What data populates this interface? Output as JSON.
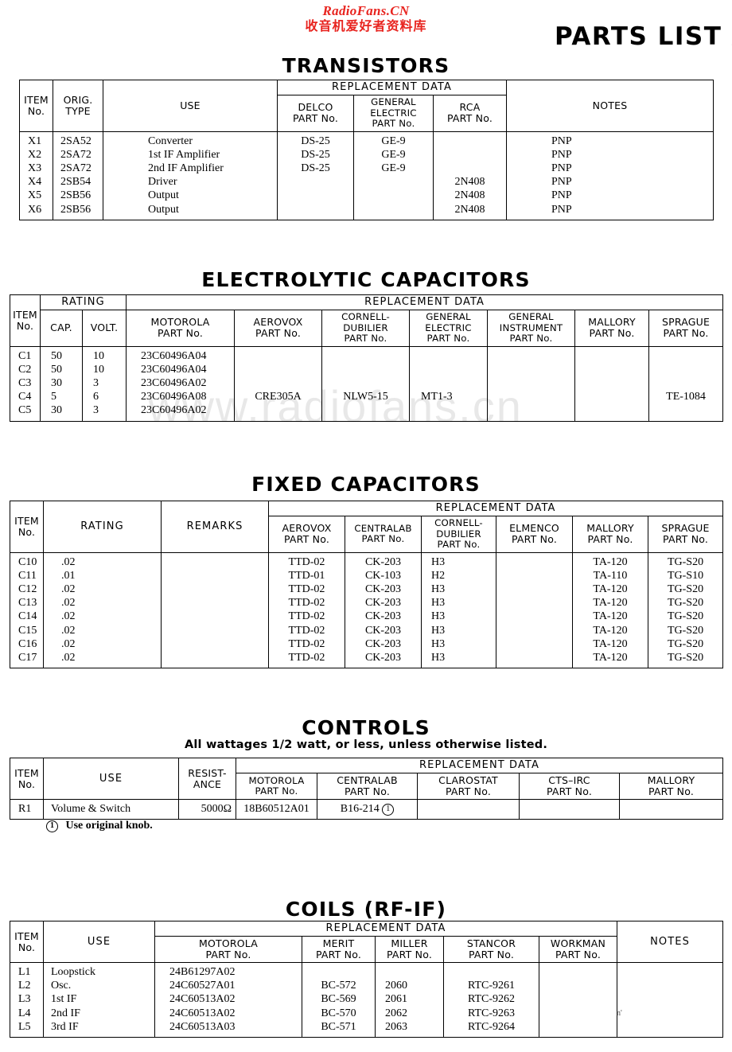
{
  "watermark": {
    "top_line1": "RadioFans.CN",
    "top_line2": "收音机爱好者资料库",
    "faint": "www.radiofans.cn"
  },
  "page_title": "PARTS LIST AN",
  "common": {
    "replacement_data": "REPLACEMENT DATA",
    "item_no": "ITEM\nNo.",
    "item_line1": "ITEM",
    "item_line2": "No.",
    "use": "USE",
    "notes": "NOTES",
    "part_no": "PART No."
  },
  "transistors": {
    "title": "TRANSISTORS",
    "headers": {
      "item_l1": "ITEM",
      "item_l2": "No.",
      "orig_l1": "ORIG.",
      "orig_l2": "TYPE",
      "use": "USE",
      "group": "REPLACEMENT DATA",
      "delco_l1": "DELCO",
      "delco_l2": "PART No.",
      "ge_l1": "GENERAL",
      "ge_l2": "ELECTRIC",
      "ge_l3": "PART No.",
      "rca_l1": "RCA",
      "rca_l2": "PART No.",
      "notes": "NOTES"
    },
    "rows": [
      {
        "item": "X1",
        "orig": "2SA52",
        "use": "Converter",
        "delco": "DS-25",
        "ge": "GE-9",
        "rca": "",
        "notes": "PNP"
      },
      {
        "item": "X2",
        "orig": "2SA72",
        "use": "1st IF Amplifier",
        "delco": "DS-25",
        "ge": "GE-9",
        "rca": "",
        "notes": "PNP"
      },
      {
        "item": "X3",
        "orig": "2SA72",
        "use": "2nd IF Amplifier",
        "delco": "DS-25",
        "ge": "GE-9",
        "rca": "",
        "notes": "PNP"
      },
      {
        "item": "X4",
        "orig": "2SB54",
        "use": "Driver",
        "delco": "",
        "ge": "",
        "rca": "2N408",
        "notes": "PNP"
      },
      {
        "item": "X5",
        "orig": "2SB56",
        "use": "Output",
        "delco": "",
        "ge": "",
        "rca": "2N408",
        "notes": "PNP"
      },
      {
        "item": "X6",
        "orig": "2SB56",
        "use": "Output",
        "delco": "",
        "ge": "",
        "rca": "2N408",
        "notes": "PNP"
      }
    ]
  },
  "electrolytic_capacitors": {
    "title": "ELECTROLYTIC CAPACITORS",
    "headers": {
      "item_l1": "ITEM",
      "item_l2": "No.",
      "rating": "RATING",
      "cap": "CAP.",
      "volt": "VOLT.",
      "group": "REPLACEMENT DATA",
      "motorola_l1": "MOTOROLA",
      "motorola_l2": "PART No.",
      "aerovox_l1": "AEROVOX",
      "aerovox_l2": "PART No.",
      "cd_l1": "CORNELL-",
      "cd_l2": "DUBILIER",
      "cd_l3": "PART No.",
      "ge_l1": "GENERAL",
      "ge_l2": "ELECTRIC",
      "ge_l3": "PART No.",
      "gi_l1": "GENERAL",
      "gi_l2": "INSTRUMENT",
      "gi_l3": "PART No.",
      "mallory_l1": "MALLORY",
      "mallory_l2": "PART No.",
      "sprague_l1": "SPRAGUE",
      "sprague_l2": "PART No."
    },
    "rows": [
      {
        "item": "C1",
        "cap": "50",
        "volt": "10",
        "motorola": "23C60496A04",
        "aerovox": "",
        "cd": "",
        "ge": "",
        "gi": "",
        "mallory": "",
        "sprague": ""
      },
      {
        "item": "C2",
        "cap": "50",
        "volt": "10",
        "motorola": "23C60496A04",
        "aerovox": "",
        "cd": "",
        "ge": "",
        "gi": "",
        "mallory": "",
        "sprague": ""
      },
      {
        "item": "C3",
        "cap": "30",
        "volt": "3",
        "motorola": "23C60496A02",
        "aerovox": "",
        "cd": "",
        "ge": "",
        "gi": "",
        "mallory": "",
        "sprague": ""
      },
      {
        "item": "C4",
        "cap": "5",
        "volt": "6",
        "motorola": "23C60496A08",
        "aerovox": "CRE305A",
        "cd": "NLW5-15",
        "ge": "MT1-3",
        "gi": "",
        "mallory": "",
        "sprague": "TE-1084"
      },
      {
        "item": "C5",
        "cap": "30",
        "volt": "3",
        "motorola": "23C60496A02",
        "aerovox": "",
        "cd": "",
        "ge": "",
        "gi": "",
        "mallory": "",
        "sprague": ""
      }
    ]
  },
  "fixed_capacitors": {
    "title": "FIXED CAPACITORS",
    "headers": {
      "item_l1": "ITEM",
      "item_l2": "No.",
      "rating": "RATING",
      "remarks": "REMARKS",
      "group": "REPLACEMENT DATA",
      "aerovox_l1": "AEROVOX",
      "aerovox_l2": "PART No.",
      "centralab_l1": "CENTRALAB",
      "centralab_l2": "PART No.",
      "cd_l1": "CORNELL-",
      "cd_l2": "DUBILIER",
      "cd_l3": "PART No.",
      "elmenco_l1": "ELMENCO",
      "elmenco_l2": "PART No.",
      "mallory_l1": "MALLORY",
      "mallory_l2": "PART No.",
      "sprague_l1": "SPRAGUE",
      "sprague_l2": "PART No."
    },
    "rows": [
      {
        "item": "C10",
        "rating": ".02",
        "remarks": "",
        "aerovox": "TTD-02",
        "centralab": "CK-203",
        "cd": "H3",
        "elmenco": "",
        "mallory": "TA-120",
        "sprague": "TG-S20"
      },
      {
        "item": "C11",
        "rating": ".01",
        "remarks": "",
        "aerovox": "TTD-01",
        "centralab": "CK-103",
        "cd": "H2",
        "elmenco": "",
        "mallory": "TA-110",
        "sprague": "TG-S10"
      },
      {
        "item": "C12",
        "rating": ".02",
        "remarks": "",
        "aerovox": "TTD-02",
        "centralab": "CK-203",
        "cd": "H3",
        "elmenco": "",
        "mallory": "TA-120",
        "sprague": "TG-S20"
      },
      {
        "item": "C13",
        "rating": ".02",
        "remarks": "",
        "aerovox": "TTD-02",
        "centralab": "CK-203",
        "cd": "H3",
        "elmenco": "",
        "mallory": "TA-120",
        "sprague": "TG-S20"
      },
      {
        "item": "C14",
        "rating": ".02",
        "remarks": "",
        "aerovox": "TTD-02",
        "centralab": "CK-203",
        "cd": "H3",
        "elmenco": "",
        "mallory": "TA-120",
        "sprague": "TG-S20"
      },
      {
        "item": "C15",
        "rating": ".02",
        "remarks": "",
        "aerovox": "TTD-02",
        "centralab": "CK-203",
        "cd": "H3",
        "elmenco": "",
        "mallory": "TA-120",
        "sprague": "TG-S20"
      },
      {
        "item": "C16",
        "rating": ".02",
        "remarks": "",
        "aerovox": "TTD-02",
        "centralab": "CK-203",
        "cd": "H3",
        "elmenco": "",
        "mallory": "TA-120",
        "sprague": "TG-S20"
      },
      {
        "item": "C17",
        "rating": ".02",
        "remarks": "",
        "aerovox": "TTD-02",
        "centralab": "CK-203",
        "cd": "H3",
        "elmenco": "",
        "mallory": "TA-120",
        "sprague": "TG-S20"
      }
    ]
  },
  "controls": {
    "title": "CONTROLS",
    "subtitle": "All wattages 1/2 watt, or less, unless otherwise listed.",
    "headers": {
      "item_l1": "ITEM",
      "item_l2": "No.",
      "use": "USE",
      "resist_l1": "RESIST-",
      "resist_l2": "ANCE",
      "group": "REPLACEMENT DATA",
      "motorola_l1": "MOTOROLA",
      "motorola_l2": "PART No.",
      "centralab_l1": "CENTRALAB",
      "centralab_l2": "PART No.",
      "clarostat_l1": "CLAROSTAT",
      "clarostat_l2": "PART No.",
      "ctsirc_l1": "CTS–IRC",
      "ctsirc_l2": "PART No.",
      "mallory_l1": "MALLORY",
      "mallory_l2": "PART No."
    },
    "rows": [
      {
        "item": "R1",
        "use": "Volume & Switch",
        "resistance": "5000Ω",
        "motorola": "18B60512A01",
        "centralab": "B16-214",
        "centralab_note": "1",
        "clarostat": "",
        "ctsirc": "",
        "mallory": ""
      }
    ],
    "footnote_marker": "1",
    "footnote_text": "Use original knob."
  },
  "coils": {
    "title": "COILS  (RF-IF)",
    "headers": {
      "item_l1": "ITEM",
      "item_l2": "No.",
      "use": "USE",
      "group": "REPLACEMENT DATA",
      "motorola_l1": "MOTOROLA",
      "motorola_l2": "PART No.",
      "merit_l1": "MERIT",
      "merit_l2": "PART No.",
      "miller_l1": "MILLER",
      "miller_l2": "PART No.",
      "stancor_l1": "STANCOR",
      "stancor_l2": "PART No.",
      "workman_l1": "WORKMAN",
      "workman_l2": "PART No.",
      "notes": "NOTES"
    },
    "rows": [
      {
        "item": "L1",
        "use": "Loopstick",
        "motorola": "24B61297A02",
        "merit": "",
        "miller": "",
        "stancor": "",
        "workman": "",
        "notes": ""
      },
      {
        "item": "L2",
        "use": "Osc.",
        "motorola": "24C60527A01",
        "merit": "BC-572",
        "miller": "2060",
        "stancor": "RTC-9261",
        "workman": "",
        "notes": ""
      },
      {
        "item": "L3",
        "use": "1st IF",
        "motorola": "24C60513A02",
        "merit": "BC-569",
        "miller": "2061",
        "stancor": "RTC-9262",
        "workman": "",
        "notes": ""
      },
      {
        "item": "L4",
        "use": "2nd IF",
        "motorola": "24C60513A02",
        "merit": "BC-570",
        "miller": "2062",
        "stancor": "RTC-9263",
        "workman": "",
        "notes": ""
      },
      {
        "item": "L5",
        "use": "3rd IF",
        "motorola": "24C60513A03",
        "merit": "BC-571",
        "miller": "2063",
        "stancor": "RTC-9264",
        "workman": "",
        "notes": ""
      }
    ]
  }
}
